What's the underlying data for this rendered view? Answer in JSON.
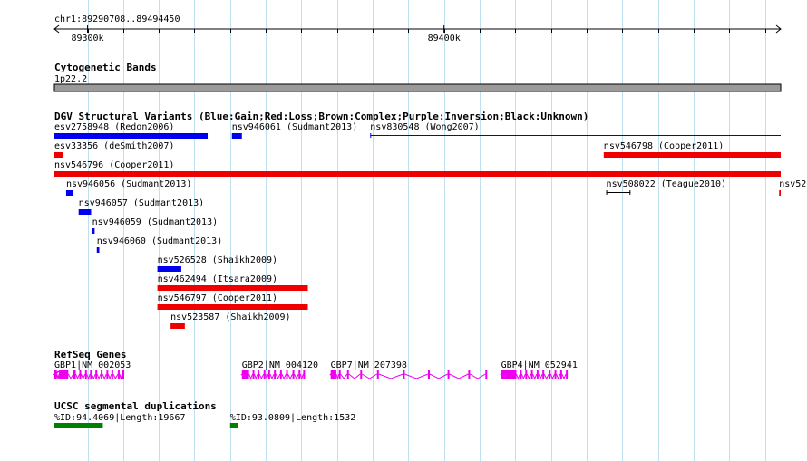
{
  "region": {
    "label": "chr1:89290708..89494450",
    "start": 89290708,
    "end": 89494450,
    "ticks": [
      {
        "pos": 89300000,
        "label": "89300k"
      },
      {
        "pos": 89400000,
        "label": "89400k"
      }
    ]
  },
  "tracks": {
    "cyto": {
      "title": "Cytogenetic Bands",
      "band_label": "1p22.2",
      "color": "#9a9a9a"
    },
    "dgv": {
      "title": "DGV Structural Variants (Blue:Gain;Red:Loss;Brown:Complex;Purple:Inversion;Black:Unknown)",
      "colors": {
        "gain": "#0000ee",
        "loss": "#ee0000",
        "unknown": "#000000"
      },
      "features": [
        {
          "label": "esv2758948 (Redon2006)",
          "type": "gain",
          "start": 89290708,
          "end": 89333700,
          "row": 0
        },
        {
          "label": "nsv946061 (Sudmant2013)",
          "type": "gain",
          "start": 89340500,
          "end": 89343300,
          "row": 0
        },
        {
          "label": "nsv830548 (Wong2007)",
          "type": "gain",
          "start": 89379300,
          "end": 89494450,
          "row": 0,
          "style": "thin",
          "open_right": true
        },
        {
          "label": "esv33356 (deSmith2007)",
          "type": "loss",
          "start": 89290708,
          "end": 89293100,
          "row": 1
        },
        {
          "label": "nsv546798 (Cooper2011)",
          "type": "loss",
          "start": 89444800,
          "end": 89494450,
          "row": 1
        },
        {
          "label": "nsv546796 (Cooper2011)",
          "type": "loss",
          "start": 89290708,
          "end": 89494450,
          "row": 2
        },
        {
          "label": "nsv946056 (Sudmant2013)",
          "type": "gain",
          "start": 89294000,
          "end": 89295800,
          "row": 3
        },
        {
          "label": "nsv508022 (Teague2010)",
          "type": "unknown",
          "start": 89445500,
          "end": 89452300,
          "row": 3,
          "style": "interval"
        },
        {
          "label": "nsv52",
          "type": "loss",
          "start": 89494000,
          "end": 89494450,
          "row": 3
        },
        {
          "label": "nsv946057 (Sudmant2013)",
          "type": "gain",
          "start": 89297500,
          "end": 89301000,
          "row": 4
        },
        {
          "label": "nsv946059 (Sudmant2013)",
          "type": "gain",
          "start": 89301300,
          "end": 89302000,
          "row": 5
        },
        {
          "label": "nsv946060 (Sudmant2013)",
          "type": "gain",
          "start": 89302600,
          "end": 89303300,
          "row": 6
        },
        {
          "label": "nsv526528 (Shaikh2009)",
          "type": "gain",
          "start": 89319600,
          "end": 89326300,
          "row": 7
        },
        {
          "label": "nsv462494 (Itsara2009)",
          "type": "loss",
          "start": 89319600,
          "end": 89361800,
          "row": 8
        },
        {
          "label": "nsv546797 (Cooper2011)",
          "type": "loss",
          "start": 89319600,
          "end": 89361800,
          "row": 9
        },
        {
          "label": "nsv523587 (Shaikh2009)",
          "type": "loss",
          "start": 89323300,
          "end": 89327300,
          "row": 10
        }
      ]
    },
    "refseq": {
      "title": "RefSeq Genes",
      "color": "#ee00ee",
      "genes": [
        {
          "label": "GBP1|NM_002053",
          "start": 89290708,
          "end": 89310300,
          "strand": "-",
          "exons": [
            [
              89290708,
              89291400
            ],
            [
              89292000,
              89294600
            ],
            [
              89296000,
              89296700
            ],
            [
              89297700,
              89298200
            ],
            [
              89299300,
              89299800
            ],
            [
              89300700,
              89301200
            ],
            [
              89302200,
              89302700
            ],
            [
              89303700,
              89304200
            ],
            [
              89305300,
              89305800
            ],
            [
              89306700,
              89307200
            ],
            [
              89308500,
              89309000
            ],
            [
              89309700,
              89310300
            ]
          ]
        },
        {
          "label": "GBP2|NM_004120",
          "start": 89343300,
          "end": 89361000,
          "strand": "-",
          "exons": [
            [
              89343300,
              89345300
            ],
            [
              89346300,
              89346800
            ],
            [
              89347700,
              89348200
            ],
            [
              89349400,
              89349900
            ],
            [
              89350700,
              89351200
            ],
            [
              89352300,
              89352800
            ],
            [
              89354000,
              89354500
            ],
            [
              89355700,
              89356200
            ],
            [
              89357500,
              89358000
            ],
            [
              89359200,
              89359700
            ],
            [
              89360500,
              89361000
            ]
          ]
        },
        {
          "label": "GBP7|NM_207398",
          "start": 89368200,
          "end": 89412100,
          "strand": "-",
          "exons": [
            [
              89368200,
              89369800
            ],
            [
              89370500,
              89371000
            ],
            [
              89372800,
              89373300
            ],
            [
              89376500,
              89377000
            ],
            [
              89381200,
              89381700
            ],
            [
              89388500,
              89389000
            ],
            [
              89395500,
              89396000
            ],
            [
              89401000,
              89401500
            ],
            [
              89406800,
              89407300
            ],
            [
              89411600,
              89412100
            ]
          ]
        },
        {
          "label": "GBP4|NM_052941",
          "start": 89416000,
          "end": 89434700,
          "strand": "-",
          "exons": [
            [
              89416000,
              89420300
            ],
            [
              89421300,
              89421800
            ],
            [
              89422800,
              89423300
            ],
            [
              89424400,
              89424900
            ],
            [
              89426000,
              89426500
            ],
            [
              89427600,
              89428100
            ],
            [
              89429400,
              89429900
            ],
            [
              89431000,
              89431500
            ],
            [
              89432600,
              89433100
            ],
            [
              89434200,
              89434700
            ]
          ]
        }
      ]
    },
    "segdup": {
      "title": "UCSC segmental duplications",
      "color": "#008000",
      "features": [
        {
          "label": "%ID:94.4069|Length:19667",
          "start": 89290708,
          "end": 89304300
        },
        {
          "label": "%ID:93.0809|Length:1532",
          "start": 89340000,
          "end": 89342100
        }
      ]
    }
  }
}
